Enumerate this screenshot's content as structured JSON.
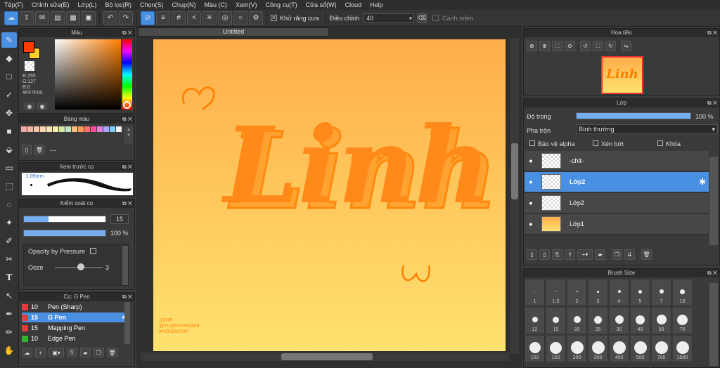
{
  "menu": [
    "Tệp(F)",
    "Chỉnh sửa(E)",
    "Lớp(L)",
    "Bộ lọc(R)",
    "Chọn(S)",
    "Chụp(N)",
    "Màu (C)",
    "Xem(V)",
    "Công cụ(T)",
    "Cửa sổ(W)",
    "Cloud",
    "Help"
  ],
  "toolbar": {
    "antialias_label": "Khử răng cưa",
    "adjust_label": "Điều chỉnh",
    "adjust_value": "40",
    "smooth_label": "Canh mềm"
  },
  "color_panel": {
    "title": "Màu",
    "r": "R:255",
    "g": "G:127",
    "b": "B:0",
    "hex": "#FF7F00",
    "fg_color": "#ff3b00",
    "bg_color": "#ffffff"
  },
  "palette_panel": {
    "title": "Bảng màu",
    "dashes": "---",
    "colors": [
      "#f4a9a8",
      "#f7b4a0",
      "#f9c6a5",
      "#fbd6b0",
      "#f8e4b8",
      "#fbeaa8",
      "#d7e8a1",
      "#bde6c6",
      "#ffbf7a",
      "#ff9a5a",
      "#ff6f6f",
      "#ff4f9a",
      "#e47fd9",
      "#a9a9ff",
      "#7ad1ff",
      "#f0f0f0"
    ]
  },
  "preview_panel": {
    "title": "Xem trước cọ",
    "size": "1.09mm"
  },
  "brush_ctrl": {
    "title": "Kiểm soát cọ",
    "size_value": "15",
    "opacity_value": "100 %",
    "pressure_label": "Opacity by Pressure",
    "ooze_label": "Ooze",
    "ooze_value": "3"
  },
  "brush_list": {
    "title": "Cọ: G Pen",
    "items": [
      {
        "size": "10",
        "name": "Pen (Sharp)",
        "color": "#e23b3b"
      },
      {
        "size": "15",
        "name": "G Pen",
        "color": "#e23b3b"
      },
      {
        "size": "15",
        "name": "Mapping Pen",
        "color": "#e23b3b"
      },
      {
        "size": "10",
        "name": "Edge Pen",
        "color": "#2bb62b"
      }
    ]
  },
  "document": {
    "tab_title": "Untitled",
    "artwork_text": "Linh",
    "signature": [
      "-CHIT-",
      "@TUQUYNH1409",
      "#HOIDAP247"
    ]
  },
  "navigator": {
    "title": "Hoa tiêu",
    "thumb_text": "Linh"
  },
  "layers": {
    "title": "Lớp",
    "opacity_label": "Độ trong",
    "opacity_value": "100 %",
    "opacity_fraction": 1.0,
    "blend_label": "Pha trộn",
    "blend_value": "Bình thường",
    "protect_alpha": "Bảo vệ alpha",
    "clipping": "Xén bớt",
    "lock": "Khóa",
    "items": [
      {
        "name": "-chit-"
      },
      {
        "name": "Lớp2"
      },
      {
        "name": "Lớp2"
      },
      {
        "name": "Lớp1"
      }
    ]
  },
  "brush_size": {
    "title": "Brush Size",
    "sizes": [
      "1",
      "1.5",
      "2",
      "3",
      "4",
      "5",
      "7",
      "10",
      "12",
      "15",
      "20",
      "25",
      "30",
      "40",
      "50",
      "70",
      "100",
      "150",
      "200",
      "300",
      "400",
      "500",
      "700",
      "1000"
    ]
  }
}
